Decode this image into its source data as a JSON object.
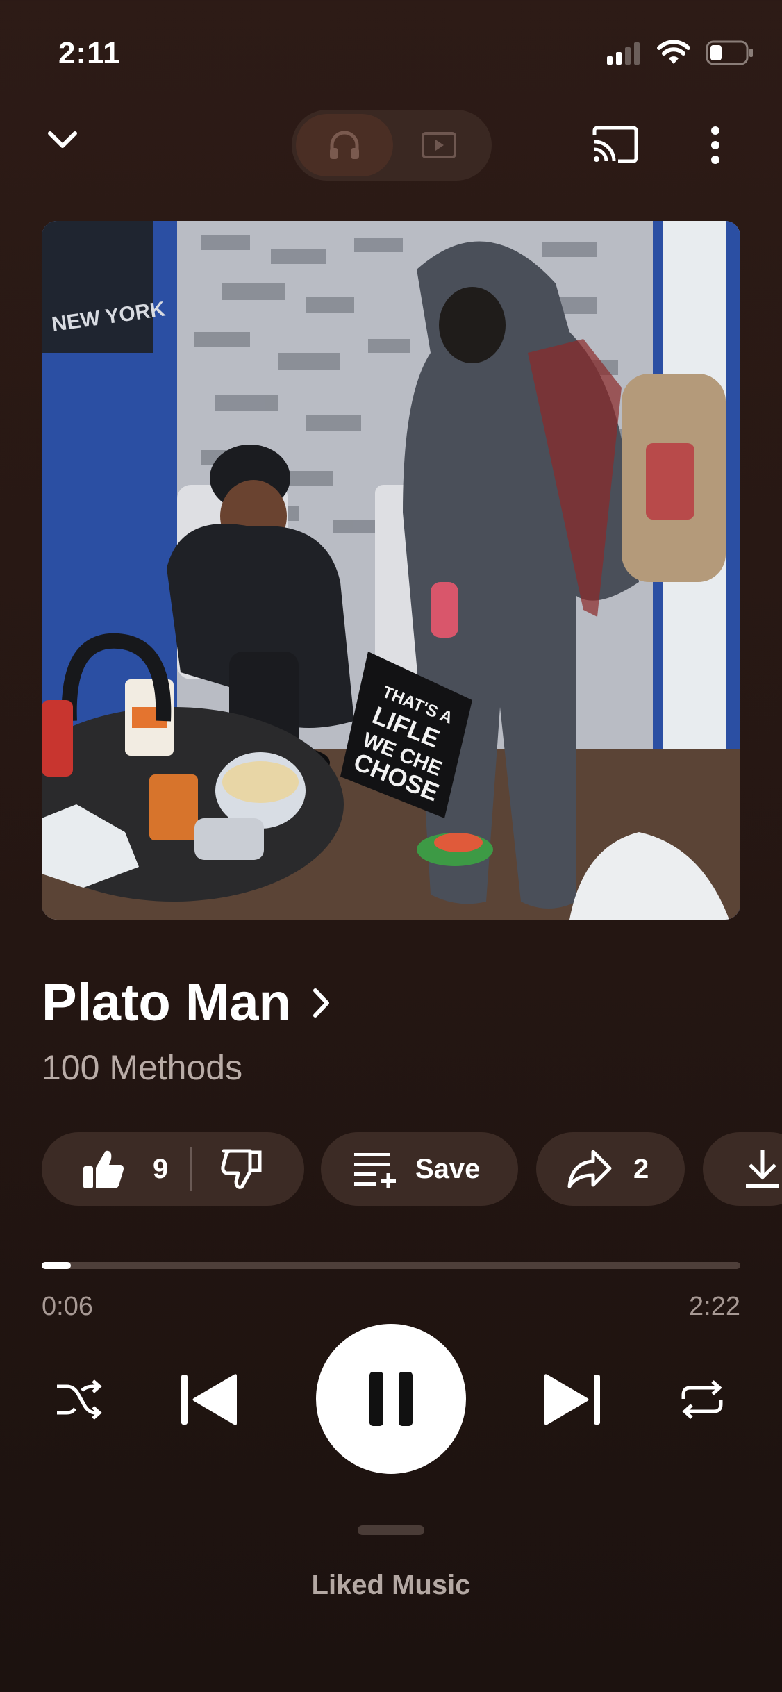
{
  "status_bar": {
    "time": "2:11"
  },
  "track": {
    "title": "Plato Man",
    "artist": "100 Methods"
  },
  "actions": {
    "like_count": "9",
    "save_label": "Save",
    "share_count": "2"
  },
  "progress": {
    "current": "0:06",
    "total": "2:22",
    "fraction": 0.042
  },
  "footer": {
    "label": "Liked Music"
  },
  "artwork": {
    "sign_text": "NEW YORK",
    "bag_text": [
      "THAT'S A",
      "LIFLE",
      "WE CHE",
      "CHOSE"
    ]
  },
  "colors": {
    "background": "#261713",
    "chip": "#3c2b25",
    "accent": "#ffffff"
  },
  "icons": [
    "chevron-down-icon",
    "headphones-icon",
    "video-icon",
    "cast-icon",
    "more-icon",
    "thumbs-up-icon",
    "thumbs-down-icon",
    "playlist-add-icon",
    "share-icon",
    "download-icon",
    "shuffle-icon",
    "previous-icon",
    "pause-icon",
    "next-icon",
    "repeat-icon"
  ]
}
